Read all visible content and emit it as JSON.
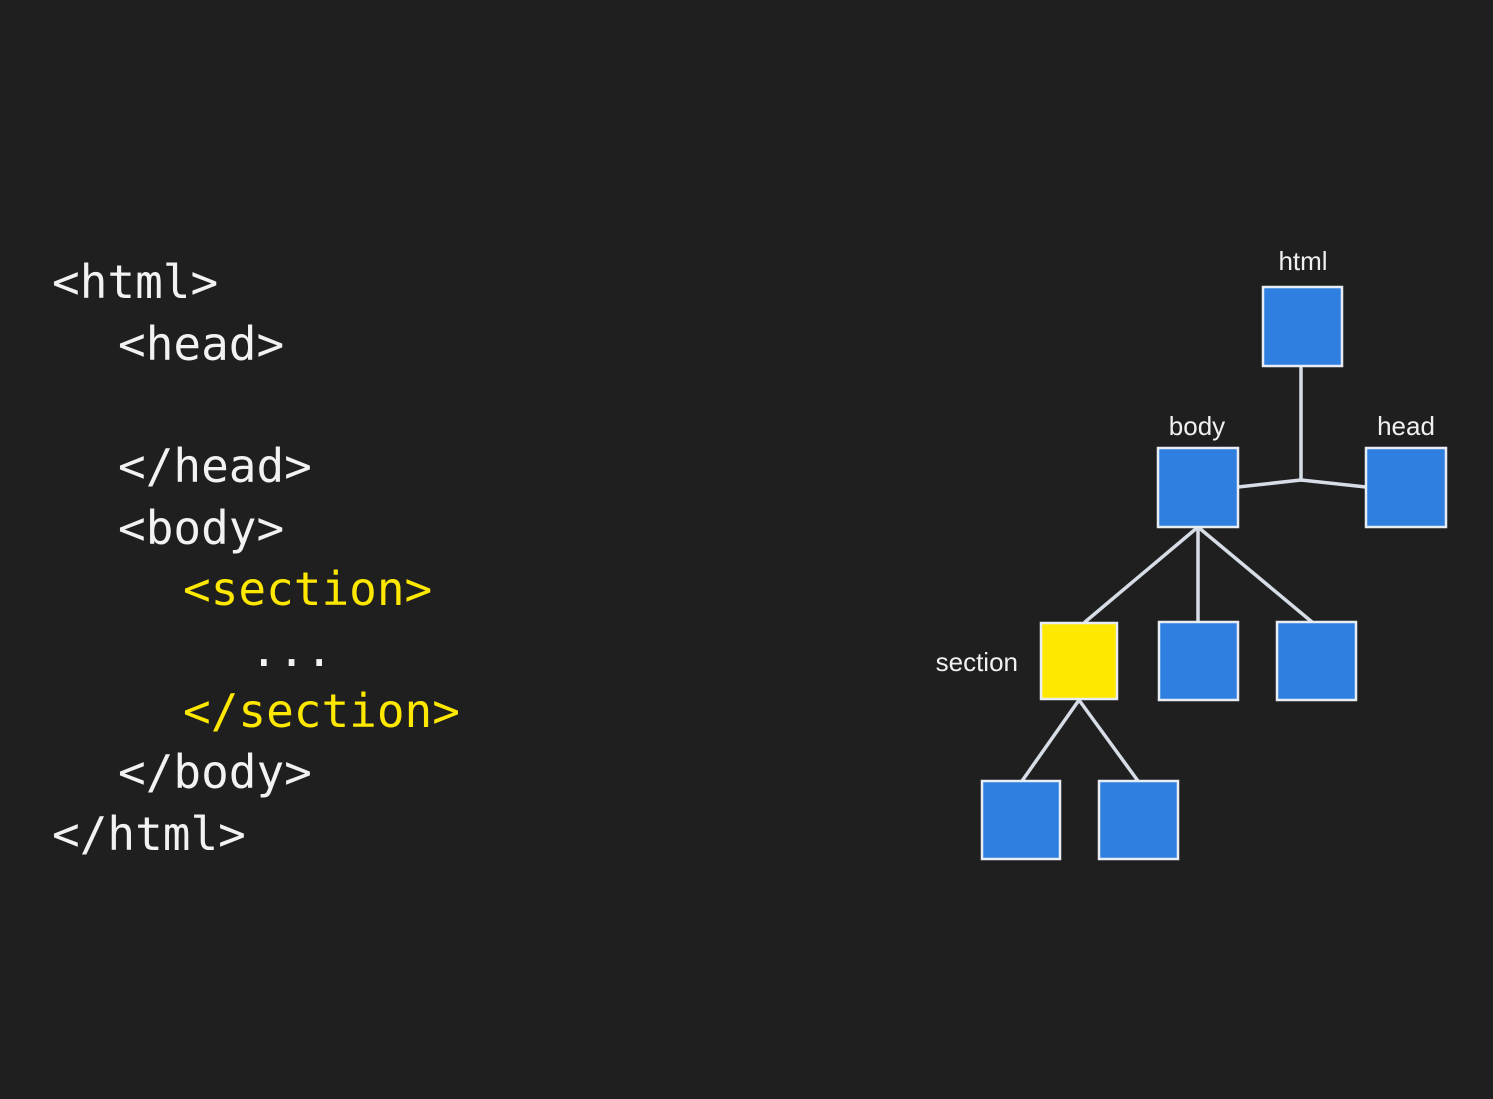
{
  "code": {
    "lines": [
      {
        "text": "<html>",
        "highlight": false
      },
      {
        "text": "<head>",
        "highlight": false
      },
      {
        "text": "</head>",
        "highlight": false
      },
      {
        "text": "<body>",
        "highlight": false
      },
      {
        "text": "<section>",
        "highlight": true
      },
      {
        "text": "...",
        "highlight": false
      },
      {
        "text": "</section>",
        "highlight": true
      },
      {
        "text": "</body>",
        "highlight": false
      },
      {
        "text": "</html>",
        "highlight": false
      }
    ]
  },
  "tree": {
    "labels": {
      "html": "html",
      "body": "body",
      "head": "head",
      "section": "section"
    },
    "colors": {
      "node": "#2f7fe0",
      "highlight": "#ffe800",
      "stroke": "#e8edf5",
      "edge": "#d7dde6",
      "background": "#1f1f1f"
    }
  }
}
